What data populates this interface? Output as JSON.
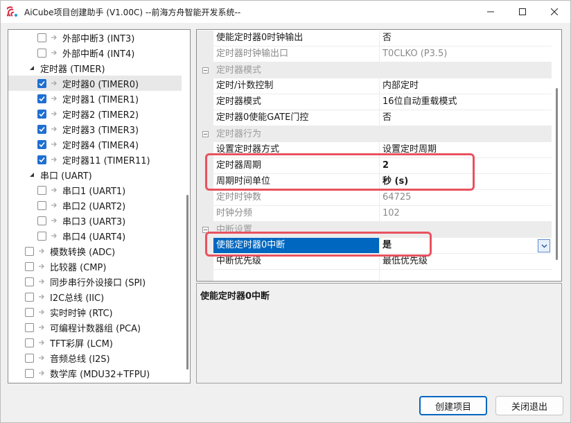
{
  "window": {
    "title": "AiCube项目创建助手 (V1.00C) --前海方舟智能开发系统--"
  },
  "tree": {
    "items": [
      {
        "label": "外部中断3 (INT3)",
        "level": 2,
        "checked": false,
        "selected": false
      },
      {
        "label": "外部中断4 (INT4)",
        "level": 2,
        "checked": false,
        "selected": false
      },
      {
        "label": "定时器 (TIMER)",
        "level": 1,
        "group": true
      },
      {
        "label": "定时器0 (TIMER0)",
        "level": 2,
        "checked": true,
        "selected": true
      },
      {
        "label": "定时器1 (TIMER1)",
        "level": 2,
        "checked": true,
        "selected": false
      },
      {
        "label": "定时器2 (TIMER2)",
        "level": 2,
        "checked": true,
        "selected": false
      },
      {
        "label": "定时器3 (TIMER3)",
        "level": 2,
        "checked": true,
        "selected": false
      },
      {
        "label": "定时器4 (TIMER4)",
        "level": 2,
        "checked": true,
        "selected": false
      },
      {
        "label": "定时器11 (TIMER11)",
        "level": 2,
        "checked": true,
        "selected": false
      },
      {
        "label": "串口 (UART)",
        "level": 1,
        "group": true
      },
      {
        "label": "串口1 (UART1)",
        "level": 2,
        "checked": false,
        "selected": false
      },
      {
        "label": "串口2 (UART2)",
        "level": 2,
        "checked": false,
        "selected": false
      },
      {
        "label": "串口3 (UART3)",
        "level": 2,
        "checked": false,
        "selected": false
      },
      {
        "label": "串口4 (UART4)",
        "level": 2,
        "checked": false,
        "selected": false
      },
      {
        "label": "模数转换 (ADC)",
        "level": 0,
        "checked": false,
        "selected": false
      },
      {
        "label": "比较器 (CMP)",
        "level": 0,
        "checked": false,
        "selected": false
      },
      {
        "label": "同步串行外设接口 (SPI)",
        "level": 0,
        "checked": false,
        "selected": false
      },
      {
        "label": "I2C总线 (IIC)",
        "level": 0,
        "checked": false,
        "selected": false
      },
      {
        "label": "实时时钟 (RTC)",
        "level": 0,
        "checked": false,
        "selected": false
      },
      {
        "label": "可编程计数器组 (PCA)",
        "level": 0,
        "checked": false,
        "selected": false
      },
      {
        "label": "TFT彩屏 (LCM)",
        "level": 0,
        "checked": false,
        "selected": false
      },
      {
        "label": "音频总线 (I2S)",
        "level": 0,
        "checked": false,
        "selected": false
      },
      {
        "label": "数学库 (MDU32+TFPU)",
        "level": 0,
        "checked": false,
        "selected": false
      }
    ]
  },
  "grid": {
    "rows": [
      {
        "type": "prop",
        "name": "使能定时器0时钟输出",
        "value": "否",
        "grey": false,
        "bold": false
      },
      {
        "type": "prop",
        "name": "定时器时钟输出口",
        "value": "T0CLKO (P3.5)",
        "grey": true,
        "bold": false
      },
      {
        "type": "cat",
        "name": "定时器模式"
      },
      {
        "type": "prop",
        "name": "定时/计数控制",
        "value": "内部定时",
        "grey": false,
        "bold": false
      },
      {
        "type": "prop",
        "name": "定时器模式",
        "value": "16位自动重载模式",
        "grey": false,
        "bold": false
      },
      {
        "type": "prop",
        "name": "定时器0使能GATE门控",
        "value": "否",
        "grey": false,
        "bold": false
      },
      {
        "type": "cat",
        "name": "定时器行为"
      },
      {
        "type": "prop",
        "name": "设置定时器方式",
        "value": "设置定时周期",
        "grey": false,
        "bold": false
      },
      {
        "type": "prop",
        "name": "定时器周期",
        "value": "2",
        "grey": false,
        "bold": true
      },
      {
        "type": "prop",
        "name": "周期时间单位",
        "value": "秒 (s)",
        "grey": false,
        "bold": true
      },
      {
        "type": "prop",
        "name": "定时时钟数",
        "value": "64725",
        "grey": true,
        "bold": false
      },
      {
        "type": "prop",
        "name": "时钟分频",
        "value": "102",
        "grey": true,
        "bold": false
      },
      {
        "type": "cat",
        "name": "中断设置"
      },
      {
        "type": "prop",
        "name": "使能定时器0中断",
        "value": "是",
        "grey": false,
        "bold": true,
        "selected": true
      },
      {
        "type": "prop",
        "name": "中断优先级",
        "value": "最低优先级",
        "grey": false,
        "bold": false
      },
      {
        "type": "blank",
        "name": "",
        "value": ""
      }
    ]
  },
  "description": {
    "title": "使能定时器0中断"
  },
  "buttons": {
    "create": "创建项目",
    "close": "关闭退出"
  },
  "colors": {
    "accent": "#0067c0",
    "highlight": "#e8525f",
    "checkbox": "#1f6fd1"
  }
}
